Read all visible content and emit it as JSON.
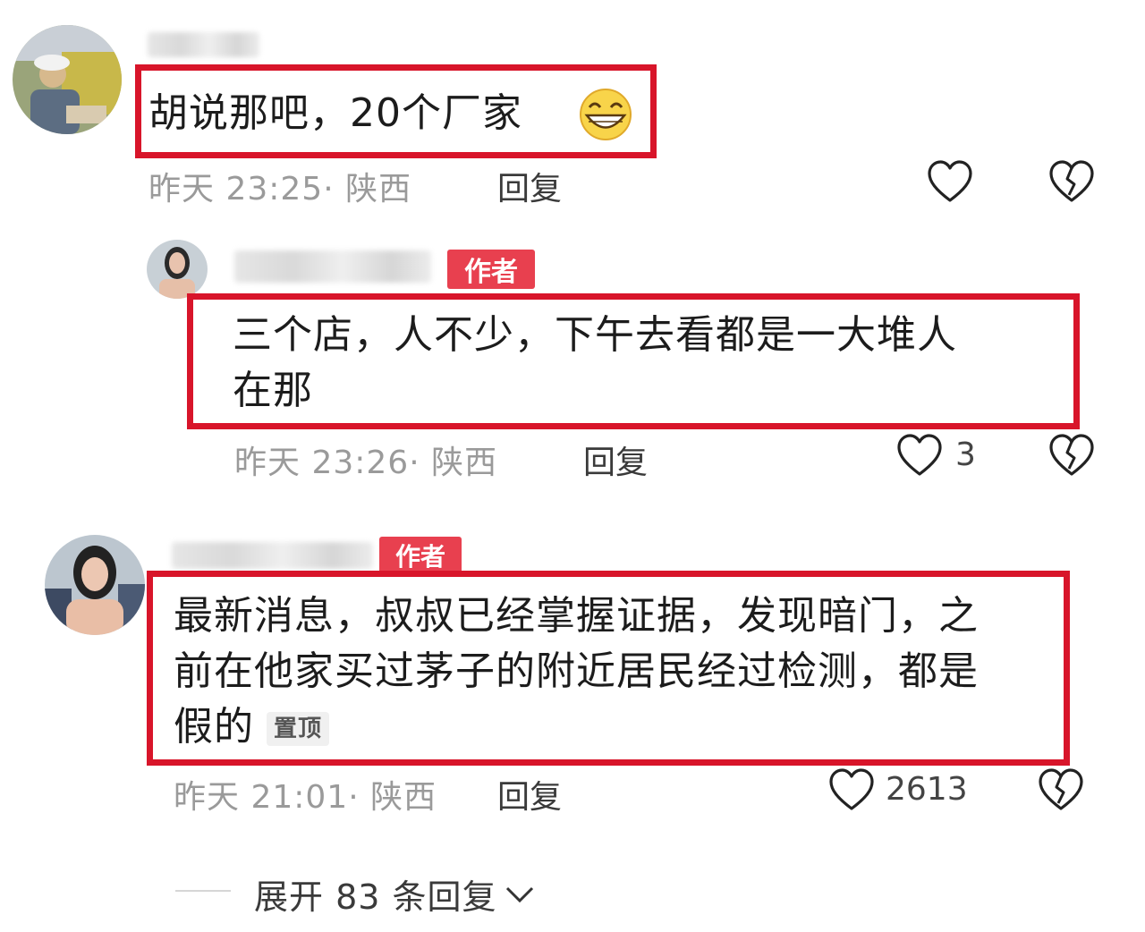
{
  "comments": [
    {
      "text": "胡说那吧，20个厂家",
      "time": "昨天 23:25",
      "location": "陕西",
      "reply_label": "回复",
      "like_count": "",
      "is_author": false
    },
    {
      "author_badge": "作者",
      "text_line1": "三个店，人不少，下午去看都是一大堆人",
      "text_line2": "在那",
      "time": "昨天 23:26",
      "location": "陕西",
      "reply_label": "回复",
      "like_count": "3",
      "is_author": true
    },
    {
      "author_badge": "作者",
      "text_line1": "最新消息，叔叔已经掌握证据，发现暗门，之",
      "text_line2": "前在他家买过茅子的附近居民经过检测，都是",
      "text_line3": "假的",
      "pin_label": "置顶",
      "time": "昨天 21:01",
      "location": "陕西",
      "reply_label": "回复",
      "like_count": "2613",
      "is_author": true
    }
  ],
  "expand_replies": "展开 83 条回复",
  "meta_separator": "·",
  "colors": {
    "highlight": "#d8152a",
    "author_badge": "#e8404f",
    "meta": "#9a9a9a"
  },
  "icons": [
    "heart-outline-icon",
    "broken-heart-icon",
    "grin-emoji-icon",
    "chevron-down-icon"
  ]
}
